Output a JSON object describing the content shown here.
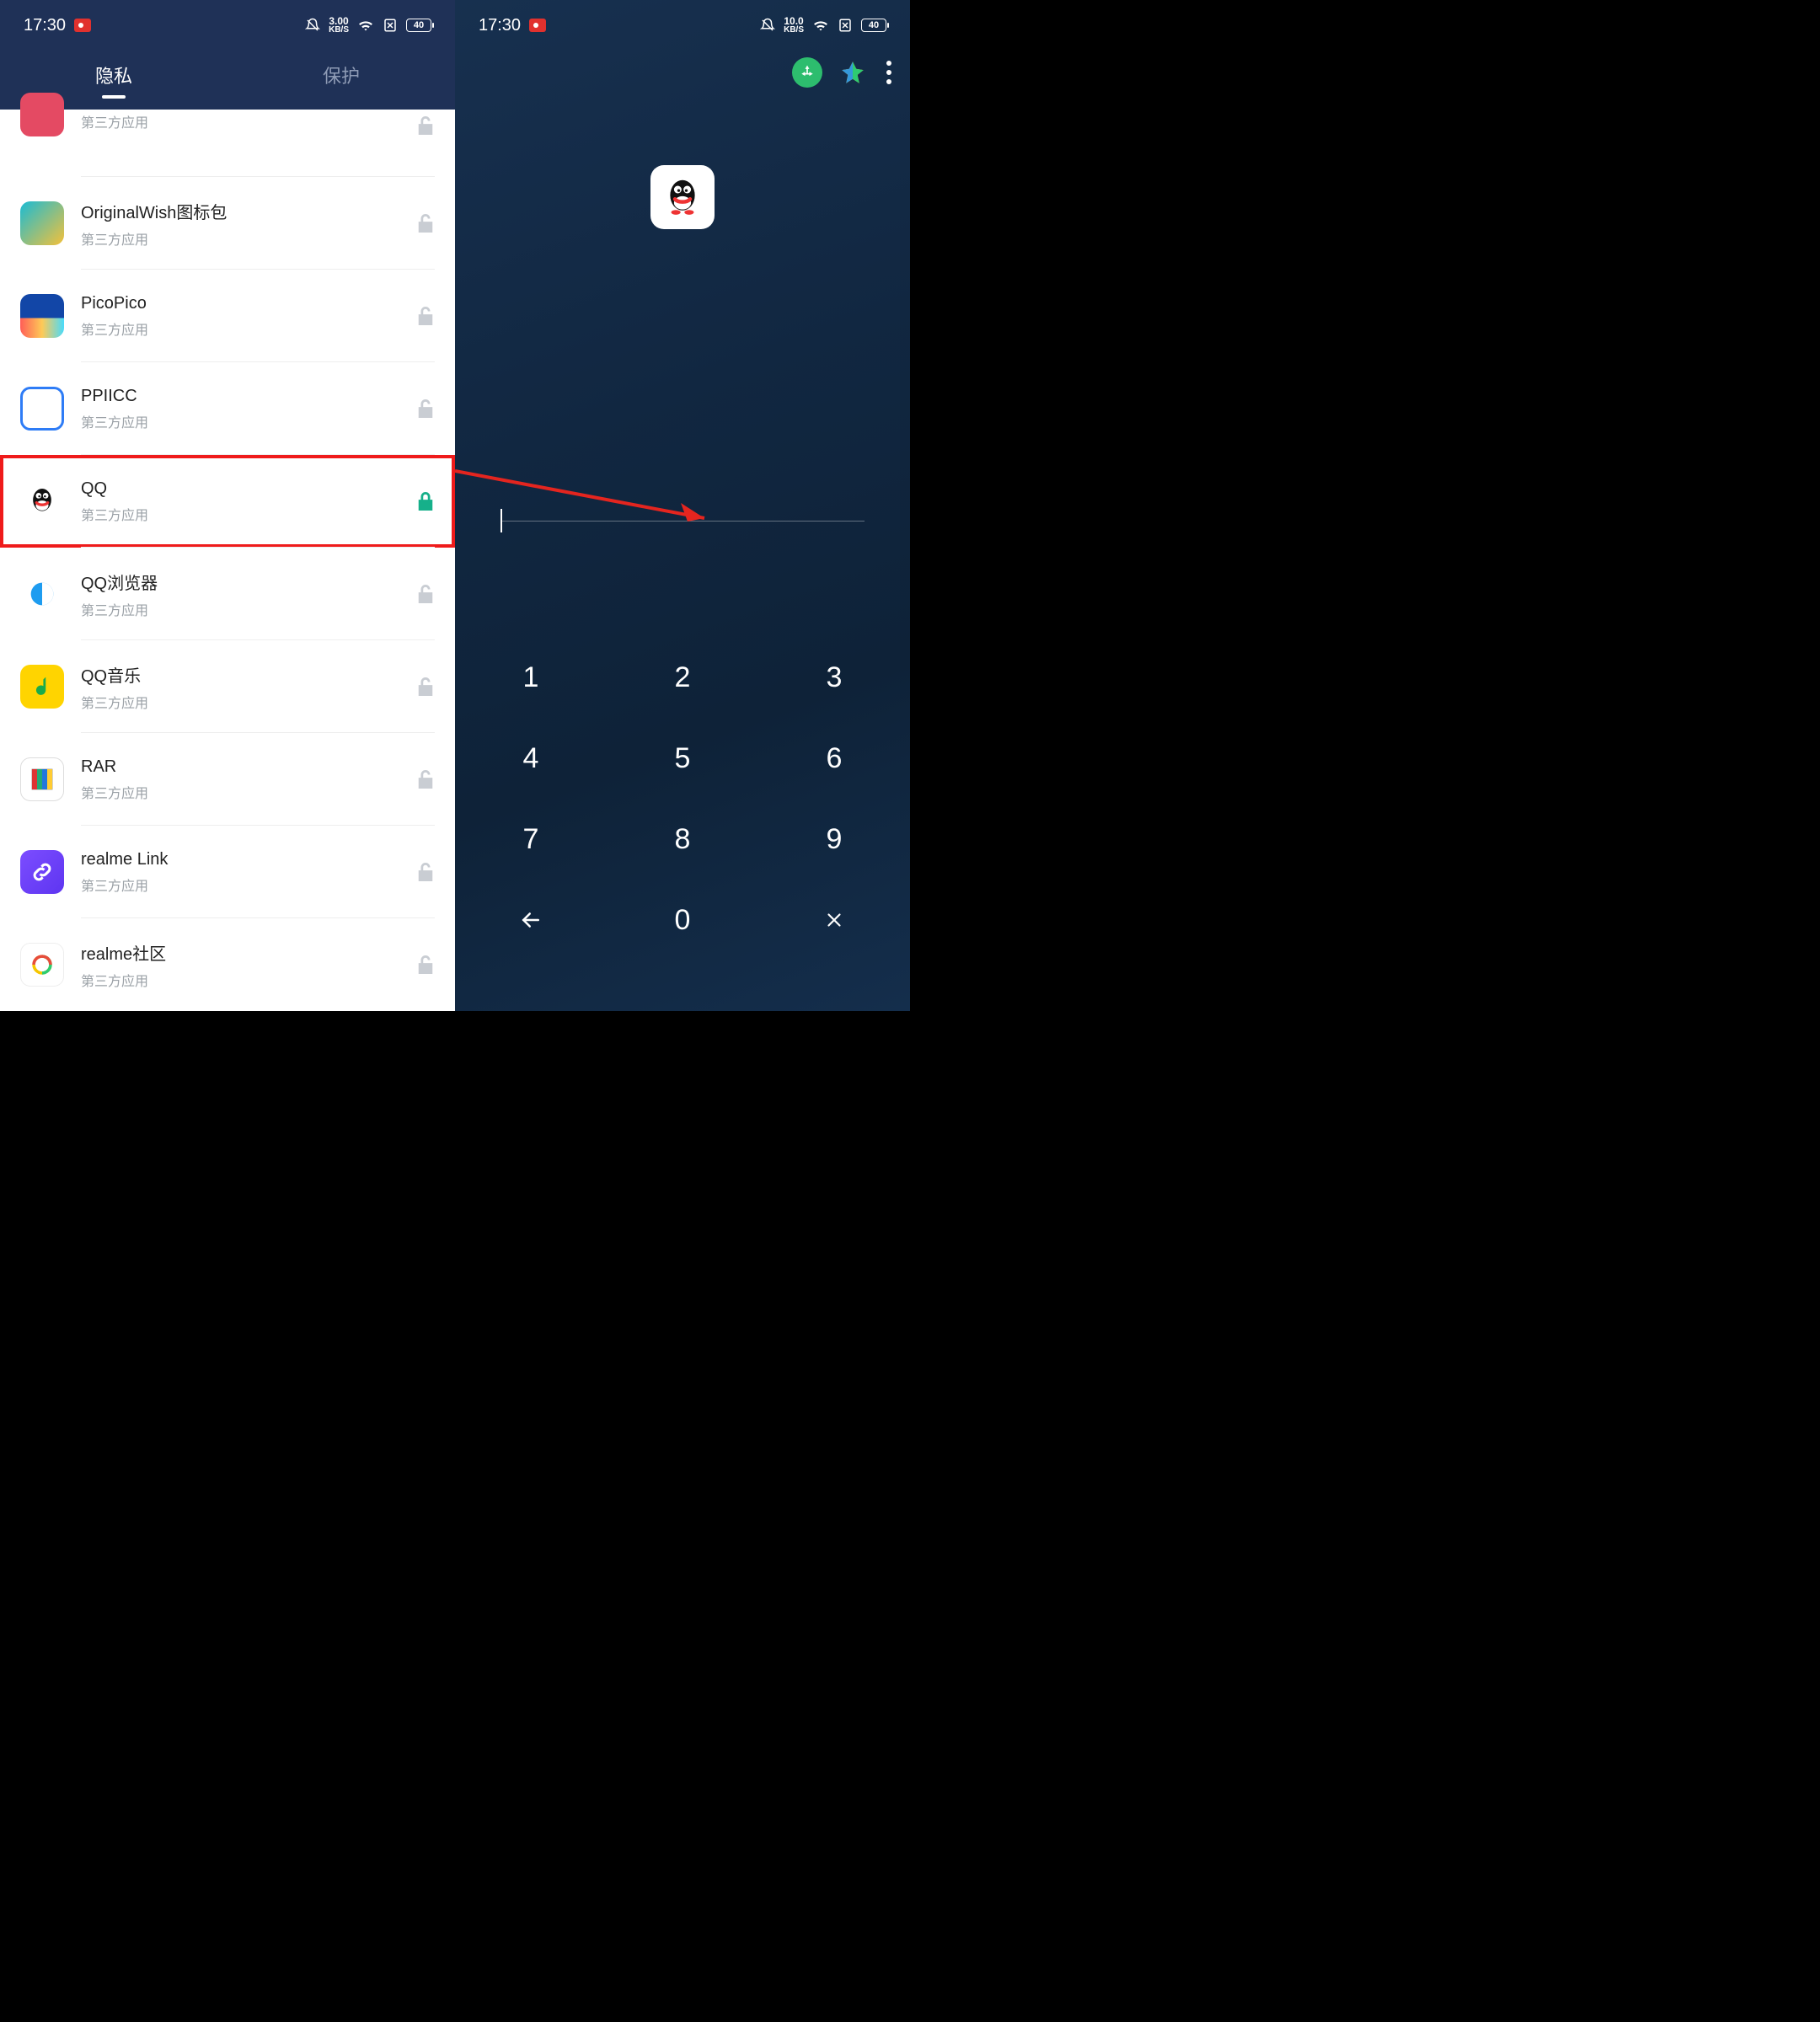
{
  "status_left": {
    "time": "17:30",
    "net_rate": "3.00",
    "net_unit": "KB/S",
    "battery": "40"
  },
  "status_right": {
    "time": "17:30",
    "net_rate": "10.0",
    "net_unit": "KB/S",
    "battery": "40"
  },
  "tabs": {
    "privacy": "隐私",
    "protect": "保护"
  },
  "third_party_label": "第三方应用",
  "apps": [
    {
      "name": "",
      "sub": "第三方应用",
      "locked": false
    },
    {
      "name": "OriginalWish图标包",
      "sub": "第三方应用",
      "locked": false
    },
    {
      "name": "PicoPico",
      "sub": "第三方应用",
      "locked": false
    },
    {
      "name": "PPIICC",
      "sub": "第三方应用",
      "locked": false
    },
    {
      "name": "QQ",
      "sub": "第三方应用",
      "locked": true
    },
    {
      "name": "QQ浏览器",
      "sub": "第三方应用",
      "locked": false
    },
    {
      "name": "QQ音乐",
      "sub": "第三方应用",
      "locked": false
    },
    {
      "name": "RAR",
      "sub": "第三方应用",
      "locked": false
    },
    {
      "name": "realme Link",
      "sub": "第三方应用",
      "locked": false
    },
    {
      "name": "realme社区",
      "sub": "第三方应用",
      "locked": false
    }
  ],
  "highlighted_app": "QQ",
  "lock_screen": {
    "app": "QQ"
  },
  "keypad": {
    "keys": [
      "1",
      "2",
      "3",
      "4",
      "5",
      "6",
      "7",
      "8",
      "9",
      "←",
      "0",
      "×"
    ]
  },
  "colors": {
    "header_bg": "#1f3157",
    "highlight_border": "#ef1b1b",
    "locked_icon": "#16b08a",
    "unlocked_icon": "#c9cdd3"
  }
}
